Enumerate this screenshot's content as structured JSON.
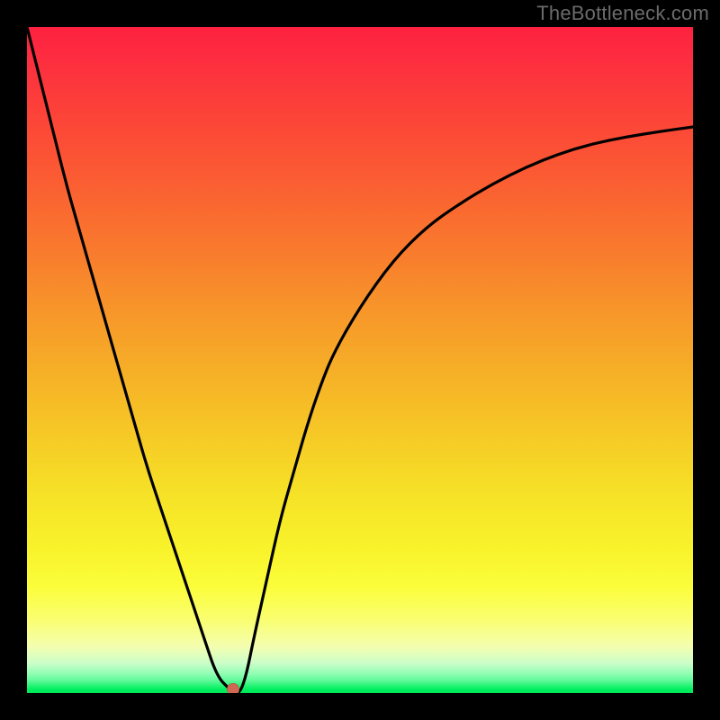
{
  "watermark": "TheBottleneck.com",
  "chart_data": {
    "type": "line",
    "title": "",
    "xlabel": "",
    "ylabel": "",
    "xlim": [
      0,
      100
    ],
    "ylim": [
      0,
      100
    ],
    "grid": false,
    "axes_visible": false,
    "background": "rainbow-vertical",
    "series": [
      {
        "name": "bottleneck-curve",
        "x": [
          0,
          2,
          4,
          6,
          8,
          10,
          12,
          14,
          16,
          18,
          20,
          22,
          24,
          26,
          27,
          28,
          29,
          30,
          31,
          32,
          33,
          34,
          36,
          38,
          40,
          42,
          44,
          46,
          50,
          55,
          60,
          65,
          70,
          75,
          80,
          85,
          90,
          95,
          100
        ],
        "y": [
          100,
          92,
          84,
          76,
          69,
          62,
          55,
          48,
          41,
          34,
          28,
          22,
          16,
          10,
          7,
          4,
          2,
          1,
          0,
          0,
          3,
          8,
          17,
          26,
          33,
          40,
          46,
          51,
          58,
          65,
          70,
          73.5,
          76.5,
          79,
          81,
          82.5,
          83.5,
          84.3,
          85
        ]
      }
    ],
    "marker": {
      "x": 31,
      "y": 0.5,
      "color": "#d16853"
    }
  },
  "colors": {
    "frame": "#000000",
    "curve": "#000000",
    "marker": "#d16853",
    "watermark": "#6b6b6b"
  }
}
